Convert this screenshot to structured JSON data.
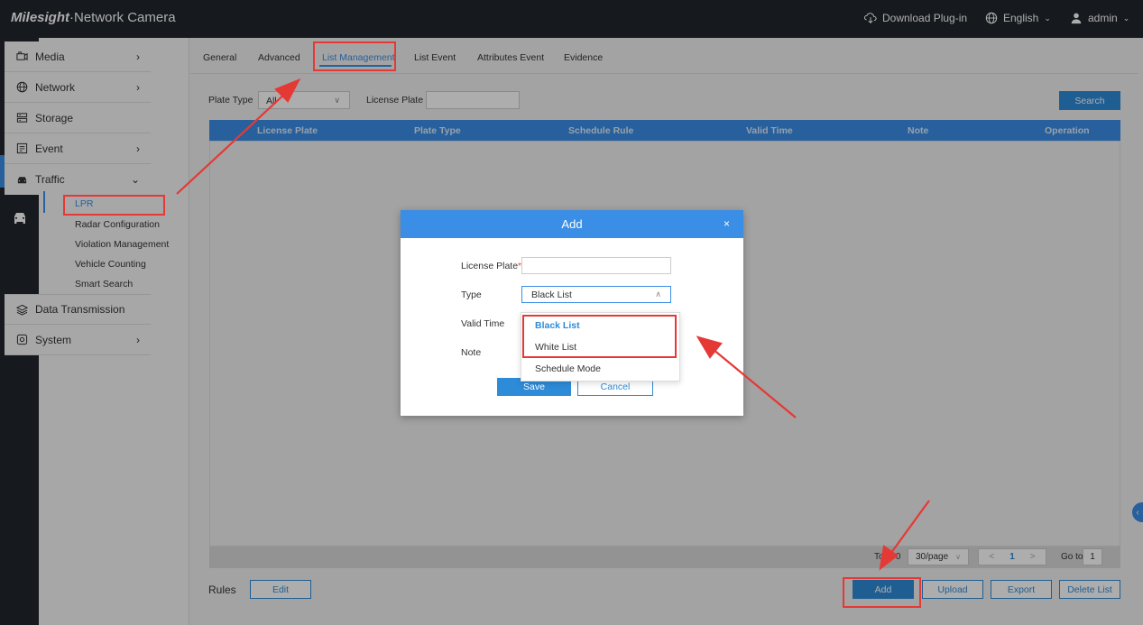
{
  "header": {
    "brand_logo": "Milesight",
    "brand_suffix": "·Network Camera",
    "download_label": "Download Plug-in",
    "language_label": "English",
    "user_label": "admin",
    "background_color": "#21252b"
  },
  "rail": {
    "items": [
      {
        "icon": "monitor-icon"
      },
      {
        "icon": "playback-icon"
      },
      {
        "icon": "settings-gears-icon",
        "active": true
      },
      {
        "icon": "car-icon"
      }
    ]
  },
  "sidebar": {
    "items": [
      {
        "label": "Media",
        "icon": "media-icon",
        "expandable": true
      },
      {
        "label": "Network",
        "icon": "globe-icon",
        "expandable": true
      },
      {
        "label": "Storage",
        "icon": "storage-icon",
        "expandable": false
      },
      {
        "label": "Event",
        "icon": "event-icon",
        "expandable": true
      },
      {
        "label": "Traffic",
        "icon": "car-icon",
        "expanded": true
      }
    ],
    "traffic_sub": [
      {
        "label": "LPR",
        "active": true
      },
      {
        "label": "Radar Configuration"
      },
      {
        "label": "Violation Management"
      },
      {
        "label": "Vehicle Counting"
      },
      {
        "label": "Smart Search"
      }
    ],
    "items_after": [
      {
        "label": "Data Transmission",
        "icon": "layers-icon"
      },
      {
        "label": "System",
        "icon": "system-icon",
        "expandable": true
      }
    ]
  },
  "tabs": [
    {
      "label": "General"
    },
    {
      "label": "Advanced"
    },
    {
      "label": "List Management",
      "active": true
    },
    {
      "label": "List Event"
    },
    {
      "label": "Attributes Event"
    },
    {
      "label": "Evidence"
    }
  ],
  "filter": {
    "plate_type_label": "Plate Type",
    "plate_type_value": "All",
    "license_plate_label": "License Plate",
    "license_plate_value": "",
    "search_label": "Search"
  },
  "table": {
    "columns": [
      "License Plate",
      "Plate Type",
      "Schedule Rule",
      "Valid Time",
      "Note",
      "Operation"
    ],
    "rows": []
  },
  "pager": {
    "total_label": "Total 0",
    "per_page": "30/page",
    "prev": "<",
    "page": "1",
    "next": ">",
    "goto_label": "Go to",
    "goto_value": "1"
  },
  "footer": {
    "rules_label": "Rules",
    "edit_label": "Edit",
    "add_label": "Add",
    "upload_label": "Upload",
    "export_label": "Export",
    "delete_label": "Delete List"
  },
  "dialog": {
    "title": "Add",
    "close": "×",
    "license_plate_label": "License Plate",
    "required_mark": "*",
    "type_label": "Type",
    "type_value": "Black List",
    "valid_time_label": "Valid Time",
    "note_label": "Note",
    "save_label": "Save",
    "cancel_label": "Cancel",
    "options": [
      "Black List",
      "White List",
      "Schedule Mode"
    ]
  },
  "colors": {
    "accent": "#3a8ee6",
    "button": "#2e8bd8",
    "annotation": "#e53935"
  }
}
